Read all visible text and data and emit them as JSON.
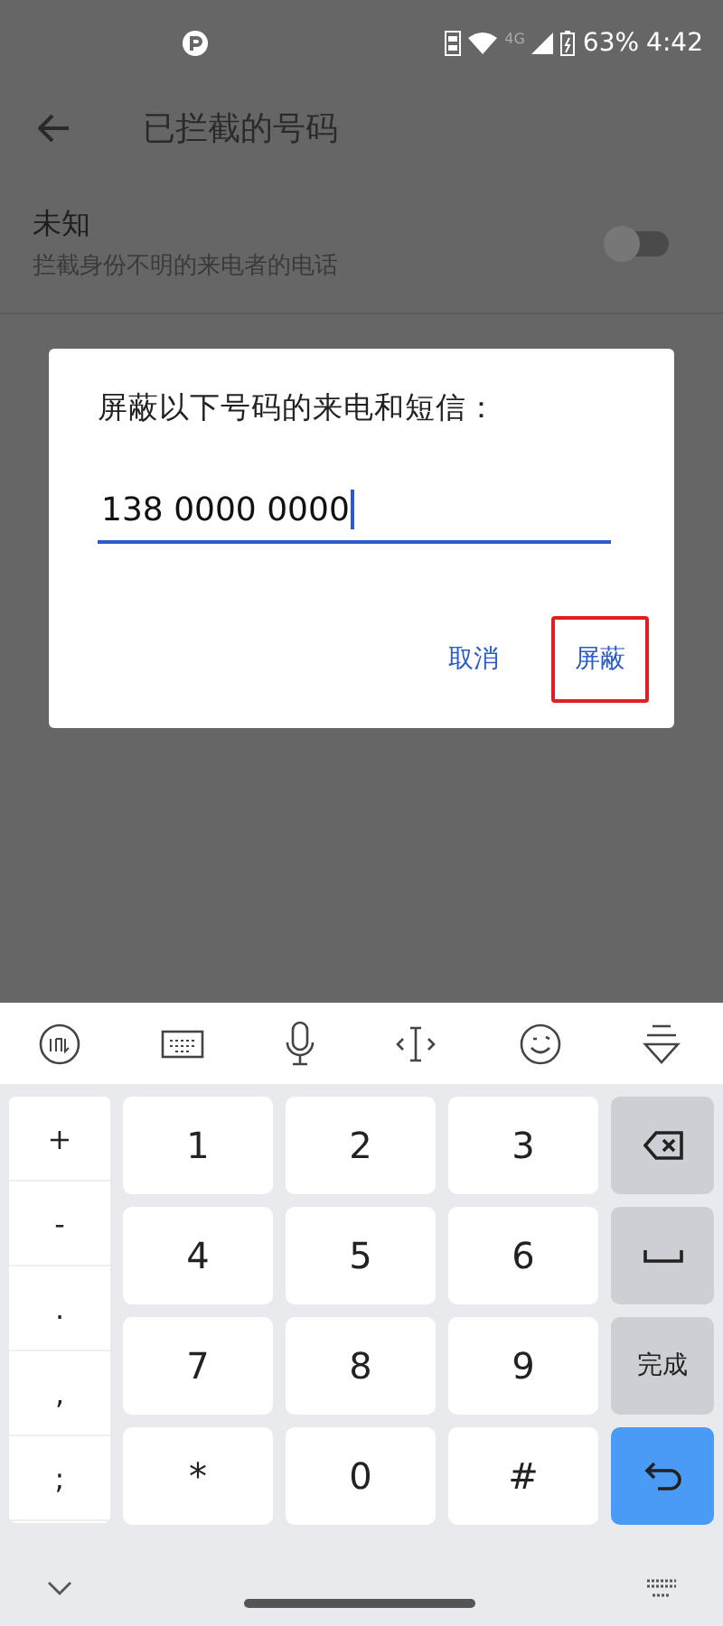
{
  "status_bar": {
    "battery": "63%",
    "time": "4:42",
    "network": "4G"
  },
  "app_bar": {
    "title": "已拦截的号码"
  },
  "unknown_setting": {
    "title": "未知",
    "subtitle": "拦截身份不明的来电者的电话",
    "on": false
  },
  "dialog": {
    "title": "屏蔽以下号码的来电和短信：",
    "value": "138 0000 0000",
    "buttons": [
      {
        "label": "取消",
        "highlighted": false
      },
      {
        "label": "屏蔽",
        "highlighted": true
      }
    ]
  },
  "keyboard": {
    "side_keys": [
      "+",
      "-",
      ".",
      ",",
      ";"
    ],
    "keys": [
      {
        "kind": "char",
        "label": "1"
      },
      {
        "kind": "char",
        "label": "2"
      },
      {
        "kind": "char",
        "label": "3"
      },
      {
        "kind": "backspace"
      },
      {
        "kind": "char",
        "label": "4"
      },
      {
        "kind": "char",
        "label": "5"
      },
      {
        "kind": "char",
        "label": "6"
      },
      {
        "kind": "space"
      },
      {
        "kind": "char",
        "label": "7"
      },
      {
        "kind": "char",
        "label": "8"
      },
      {
        "kind": "char",
        "label": "9"
      },
      {
        "kind": "done",
        "label": "完成"
      },
      {
        "kind": "char",
        "label": "*"
      },
      {
        "kind": "char",
        "label": "0"
      },
      {
        "kind": "char",
        "label": "#"
      },
      {
        "kind": "enter"
      }
    ]
  }
}
